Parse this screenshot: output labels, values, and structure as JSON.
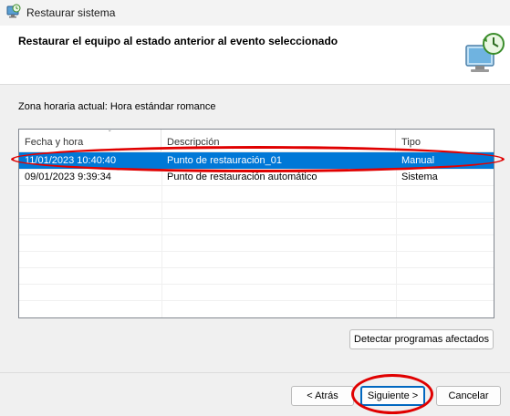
{
  "window": {
    "title": "Restaurar sistema",
    "app_icon": "system-restore-icon"
  },
  "header": {
    "heading": "Restaurar el equipo al estado anterior al evento seleccionado",
    "icon": "monitor-restore-icon"
  },
  "timezone_label": "Zona horaria actual: Hora estándar romance",
  "table": {
    "columns": [
      "Fecha y hora",
      "Descripción",
      "Tipo"
    ],
    "sort_indicator": "ˇ",
    "rows": [
      {
        "date": "11/01/2023 10:40:40",
        "description": "Punto de restauración_01",
        "type": "Manual",
        "selected": true
      },
      {
        "date": "09/01/2023 9:39:34",
        "description": "Punto de restauración automático",
        "type": "Sistema",
        "selected": false
      }
    ]
  },
  "buttons": {
    "detect": "Detectar programas afectados",
    "back": "< Atrás",
    "next": "Siguiente >",
    "cancel": "Cancelar"
  },
  "colors": {
    "selection": "#0078d7",
    "annotation": "#e00000",
    "primary_border": "#0067c0"
  }
}
